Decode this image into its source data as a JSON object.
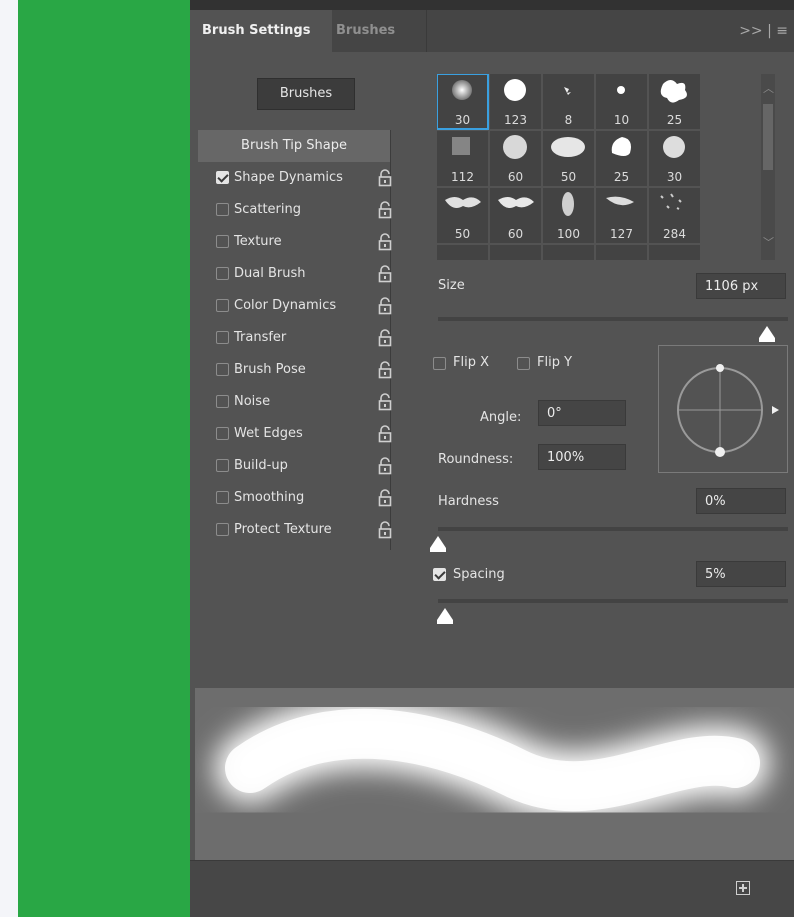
{
  "panel": {
    "tabs": [
      {
        "label": "Brush Settings"
      },
      {
        "label": "Brushes"
      }
    ],
    "menu_glyph": ">> | ≡"
  },
  "brushes_button": {
    "label": "Brushes"
  },
  "sidebar": {
    "header": "Brush Tip Shape",
    "items": [
      {
        "label": "Shape Dynamics",
        "checked": true
      },
      {
        "label": "Scattering",
        "checked": false
      },
      {
        "label": "Texture",
        "checked": false
      },
      {
        "label": "Dual Brush",
        "checked": false
      },
      {
        "label": "Color Dynamics",
        "checked": false
      },
      {
        "label": "Transfer",
        "checked": false
      },
      {
        "label": "Brush Pose",
        "checked": false
      },
      {
        "label": "Noise",
        "checked": false
      },
      {
        "label": "Wet Edges",
        "checked": false
      },
      {
        "label": "Build-up",
        "checked": false
      },
      {
        "label": "Smoothing",
        "checked": false
      },
      {
        "label": "Protect Texture",
        "checked": false
      }
    ]
  },
  "brush_presets": [
    {
      "size": "30",
      "selected": true
    },
    {
      "size": "123"
    },
    {
      "size": "8"
    },
    {
      "size": "10"
    },
    {
      "size": "25"
    },
    {
      "size": "112"
    },
    {
      "size": "60"
    },
    {
      "size": "50"
    },
    {
      "size": "25"
    },
    {
      "size": "30"
    },
    {
      "size": "50"
    },
    {
      "size": "60"
    },
    {
      "size": "100"
    },
    {
      "size": "127"
    },
    {
      "size": "284"
    }
  ],
  "size": {
    "label": "Size",
    "value": "1106 px",
    "level": 0.94
  },
  "flip": {
    "x_label": "Flip X",
    "y_label": "Flip Y"
  },
  "angle": {
    "label": "Angle:",
    "value": "0°"
  },
  "roundness": {
    "label": "Roundness:",
    "value": "100%"
  },
  "hardness": {
    "label": "Hardness",
    "value": "0%",
    "level": 0.0
  },
  "spacing": {
    "label": "Spacing",
    "value": "5%",
    "checked": true,
    "level": 0.02
  },
  "colors": {
    "panel": "#535353",
    "selection": "#3aa0e0",
    "green": "#29a745"
  },
  "icons": {
    "lock": "lock-icon",
    "new_brush": "create-new-brush-icon"
  }
}
